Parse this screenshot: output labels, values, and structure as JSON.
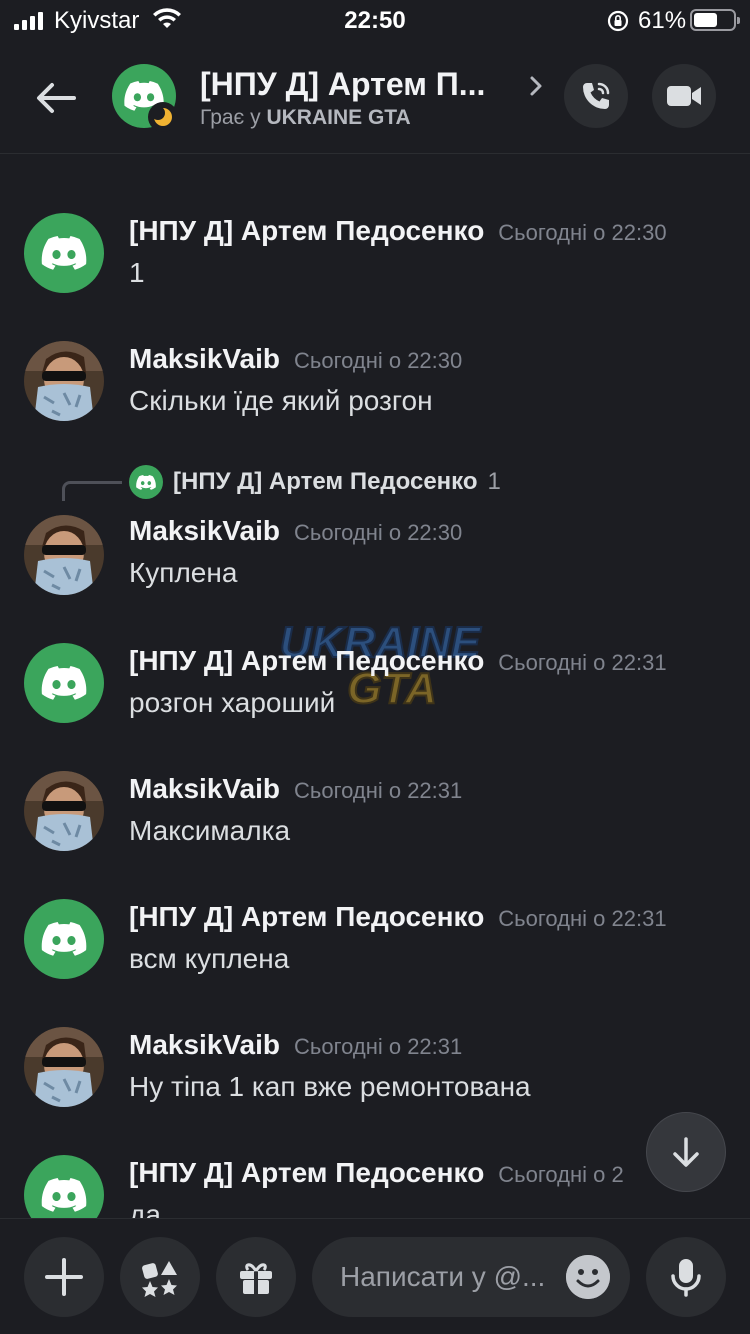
{
  "status_bar": {
    "carrier": "Kyivstar",
    "time": "22:50",
    "battery_percent": "61%",
    "battery_level": 0.61
  },
  "header": {
    "title": "[НПУ Д] Артем П...",
    "status_prefix": "Грає у",
    "status_game": "UKRAINE GTA"
  },
  "messages": [
    {
      "author": "[НПУ Д] Артем Педосенко",
      "time": "Сьогодні о 22:30",
      "text": "1",
      "avatar": "discord-logo"
    },
    {
      "author": "MaksikVaib",
      "time": "Сьогодні о 22:30",
      "text": "Скільки їде який розгон",
      "avatar": "user-photo"
    },
    {
      "reply_to": {
        "author": "[НПУ Д] Артем Педосенко",
        "text": "1"
      },
      "author": "MaksikVaib",
      "time": "Сьогодні о 22:30",
      "text": "Куплена",
      "avatar": "user-photo"
    },
    {
      "author": "[НПУ Д] Артем Педосенко",
      "time": "Сьогодні о 22:31",
      "text": "розгон хароший",
      "avatar": "discord-logo"
    },
    {
      "author": "MaksikVaib",
      "time": "Сьогодні о 22:31",
      "text": "Максималка",
      "avatar": "user-photo"
    },
    {
      "author": "[НПУ Д] Артем Педосенко",
      "time": "Сьогодні о 22:31",
      "text": "всм куплена",
      "avatar": "discord-logo"
    },
    {
      "author": "MaksikVaib",
      "time": "Сьогодні о 22:31",
      "text": "Ну тіпа 1 кап вже ремонтована",
      "avatar": "user-photo"
    },
    {
      "author": "[НПУ Д] Артем Педосенко",
      "time": "Сьогодні о 2",
      "text": "да",
      "avatar": "discord-logo"
    }
  ],
  "watermark": {
    "line1": "UKRAINE",
    "line2": "GTA"
  },
  "composer": {
    "placeholder": "Написати у @..."
  },
  "colors": {
    "background": "#1c1d22",
    "discord_green": "#3ba55c",
    "surface": "#2b2d31"
  }
}
